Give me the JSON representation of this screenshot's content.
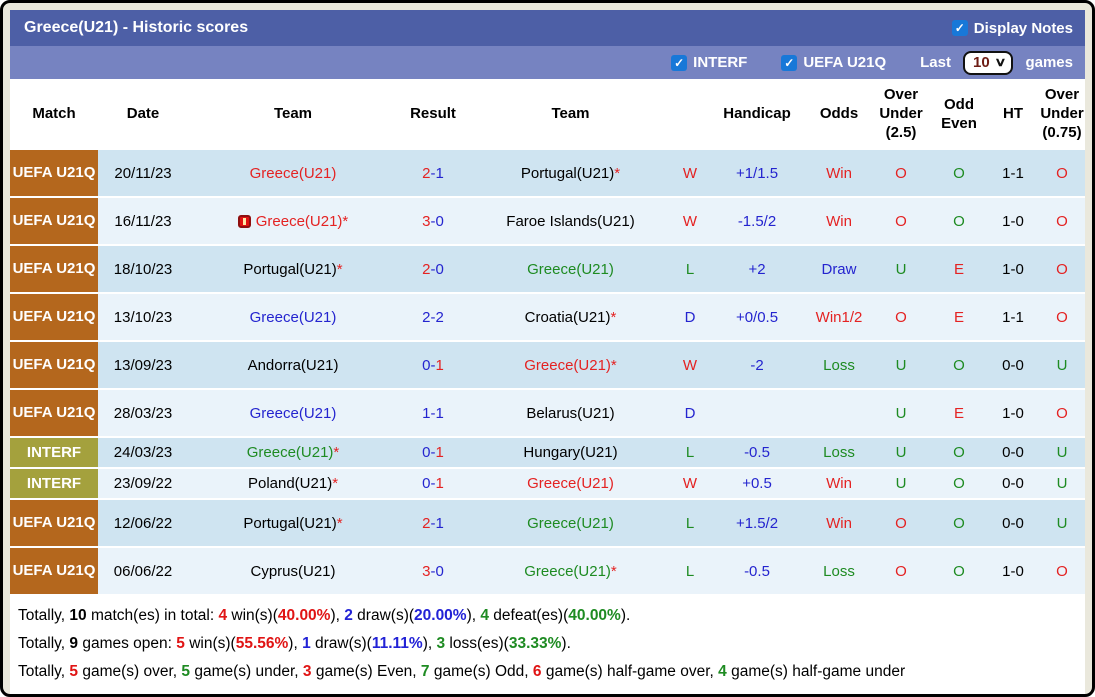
{
  "header": {
    "title": "Greece(U21) - Historic scores",
    "display_notes_label": "Display Notes"
  },
  "filters": {
    "interf_label": "INTERF",
    "uefa_label": "UEFA U21Q",
    "last_label": "Last",
    "last_value": "10",
    "games_label": "games"
  },
  "colors": {
    "titlebar": "#4d5fa6",
    "subbar": "#7683c1",
    "uefa_cell": "#b4671d",
    "interf_cell": "#a4a13d",
    "row_light_blue": "#cfe4f1",
    "row_pale_blue": "#eaf3fa",
    "win_red": "#e42222",
    "draw_blue": "#2424cf",
    "loss_green": "#1e8b22",
    "checkbox_blue": "#1878d8"
  },
  "table": {
    "columns": [
      "Match",
      "Date",
      "Team",
      "Result",
      "Team",
      "",
      "Handicap",
      "Odds",
      "Over\nUnder\n(2.5)",
      "Odd\nEven",
      "HT",
      "Over\nUnder\n(0.75)"
    ],
    "rows": [
      {
        "match": "UEFA U21Q",
        "date": "20/11/23",
        "home": {
          "name": "Greece(U21)",
          "star": ""
        },
        "score": {
          "h": "2",
          "d": "-",
          "a": "1"
        },
        "away": {
          "name": "Portugal(U21)",
          "star": "*"
        },
        "wld": "W",
        "handicap": "+1/1.5",
        "odds": "Win",
        "ou25": "O",
        "odd_even": "O",
        "ht": "1-1",
        "ou075": "O"
      },
      {
        "match": "UEFA U21Q",
        "date": "16/11/23",
        "home": {
          "name": "Greece(U21)",
          "star": "*"
        },
        "score": {
          "h": "3",
          "d": "-",
          "a": "0"
        },
        "away": {
          "name": "Faroe Islands(U21)",
          "star": ""
        },
        "wld": "W",
        "handicap": "-1.5/2",
        "odds": "Win",
        "ou25": "O",
        "odd_even": "O",
        "ht": "1-0",
        "ou075": "O"
      },
      {
        "match": "UEFA U21Q",
        "date": "18/10/23",
        "home": {
          "name": "Portugal(U21)",
          "star": "*"
        },
        "score": {
          "h": "2",
          "d": "-",
          "a": "0"
        },
        "away": {
          "name": "Greece(U21)",
          "star": ""
        },
        "wld": "L",
        "handicap": "+2",
        "odds": "Draw",
        "ou25": "U",
        "odd_even": "E",
        "ht": "1-0",
        "ou075": "O"
      },
      {
        "match": "UEFA U21Q",
        "date": "13/10/23",
        "home": {
          "name": "Greece(U21)",
          "star": ""
        },
        "score": {
          "h": "2",
          "d": "-",
          "a": "2"
        },
        "away": {
          "name": "Croatia(U21)",
          "star": "*"
        },
        "wld": "D",
        "handicap": "+0/0.5",
        "odds": "Win1/2",
        "ou25": "O",
        "odd_even": "E",
        "ht": "1-1",
        "ou075": "O"
      },
      {
        "match": "UEFA U21Q",
        "date": "13/09/23",
        "home": {
          "name": "Andorra(U21)",
          "star": ""
        },
        "score": {
          "h": "0",
          "d": "-",
          "a": "1"
        },
        "away": {
          "name": "Greece(U21)",
          "star": "*"
        },
        "wld": "W",
        "handicap": "-2",
        "odds": "Loss",
        "ou25": "U",
        "odd_even": "O",
        "ht": "0-0",
        "ou075": "U"
      },
      {
        "match": "UEFA U21Q",
        "date": "28/03/23",
        "home": {
          "name": "Greece(U21)",
          "star": ""
        },
        "score": {
          "h": "1",
          "d": "-",
          "a": "1"
        },
        "away": {
          "name": "Belarus(U21)",
          "star": ""
        },
        "wld": "D",
        "handicap": "",
        "odds": "",
        "ou25": "U",
        "odd_even": "E",
        "ht": "1-0",
        "ou075": "O"
      },
      {
        "match": "INTERF",
        "date": "24/03/23",
        "home": {
          "name": "Greece(U21)",
          "star": "*"
        },
        "score": {
          "h": "0",
          "d": "-",
          "a": "1"
        },
        "away": {
          "name": "Hungary(U21)",
          "star": ""
        },
        "wld": "L",
        "handicap": "-0.5",
        "odds": "Loss",
        "ou25": "U",
        "odd_even": "O",
        "ht": "0-0",
        "ou075": "U"
      },
      {
        "match": "INTERF",
        "date": "23/09/22",
        "home": {
          "name": "Poland(U21)",
          "star": "*"
        },
        "score": {
          "h": "0",
          "d": "-",
          "a": "1"
        },
        "away": {
          "name": "Greece(U21)",
          "star": ""
        },
        "wld": "W",
        "handicap": "+0.5",
        "odds": "Win",
        "ou25": "U",
        "odd_even": "O",
        "ht": "0-0",
        "ou075": "U"
      },
      {
        "match": "UEFA U21Q",
        "date": "12/06/22",
        "home": {
          "name": "Portugal(U21)",
          "star": "*"
        },
        "score": {
          "h": "2",
          "d": "-",
          "a": "1"
        },
        "away": {
          "name": "Greece(U21)",
          "star": ""
        },
        "wld": "L",
        "handicap": "+1.5/2",
        "odds": "Win",
        "ou25": "O",
        "odd_even": "O",
        "ht": "0-0",
        "ou075": "U"
      },
      {
        "match": "UEFA U21Q",
        "date": "06/06/22",
        "home": {
          "name": "Cyprus(U21)",
          "star": ""
        },
        "score": {
          "h": "3",
          "d": "-",
          "a": "0"
        },
        "away": {
          "name": "Greece(U21)",
          "star": "*"
        },
        "wld": "L",
        "handicap": "-0.5",
        "odds": "Loss",
        "ou25": "O",
        "odd_even": "O",
        "ht": "1-0",
        "ou075": "O"
      }
    ]
  },
  "summary": {
    "line1": [
      {
        "t": "Totally, ",
        "c": "k"
      },
      {
        "t": "10",
        "c": "kb"
      },
      {
        "t": " match(es) in total: ",
        "c": "k"
      },
      {
        "t": "4",
        "c": "rb"
      },
      {
        "t": " win(s)(",
        "c": "k"
      },
      {
        "t": "40.00%",
        "c": "rb"
      },
      {
        "t": "), ",
        "c": "k"
      },
      {
        "t": "2",
        "c": "bb"
      },
      {
        "t": " draw(s)(",
        "c": "k"
      },
      {
        "t": "20.00%",
        "c": "bb"
      },
      {
        "t": "), ",
        "c": "k"
      },
      {
        "t": "4",
        "c": "gb"
      },
      {
        "t": " defeat(es)(",
        "c": "k"
      },
      {
        "t": "40.00%",
        "c": "gb"
      },
      {
        "t": ").",
        "c": "k"
      }
    ],
    "line2": [
      {
        "t": "Totally, ",
        "c": "k"
      },
      {
        "t": "9",
        "c": "kb"
      },
      {
        "t": " games open: ",
        "c": "k"
      },
      {
        "t": "5",
        "c": "rb"
      },
      {
        "t": " win(s)(",
        "c": "k"
      },
      {
        "t": "55.56%",
        "c": "rb"
      },
      {
        "t": "), ",
        "c": "k"
      },
      {
        "t": "1",
        "c": "bb"
      },
      {
        "t": " draw(s)(",
        "c": "k"
      },
      {
        "t": "11.11%",
        "c": "bb"
      },
      {
        "t": "), ",
        "c": "k"
      },
      {
        "t": "3",
        "c": "gb"
      },
      {
        "t": " loss(es)(",
        "c": "k"
      },
      {
        "t": "33.33%",
        "c": "gb"
      },
      {
        "t": ").",
        "c": "k"
      }
    ],
    "line3": [
      {
        "t": "Totally, ",
        "c": "k"
      },
      {
        "t": "5",
        "c": "rb"
      },
      {
        "t": " game(s) over, ",
        "c": "k"
      },
      {
        "t": "5",
        "c": "gb"
      },
      {
        "t": " game(s) under, ",
        "c": "k"
      },
      {
        "t": "3",
        "c": "rb"
      },
      {
        "t": " game(s) Even, ",
        "c": "k"
      },
      {
        "t": "7",
        "c": "gb"
      },
      {
        "t": " game(s) Odd, ",
        "c": "k"
      },
      {
        "t": "6",
        "c": "rb"
      },
      {
        "t": " game(s) half-game over, ",
        "c": "k"
      },
      {
        "t": "4",
        "c": "gb"
      },
      {
        "t": " game(s) half-game under",
        "c": "k"
      }
    ]
  }
}
